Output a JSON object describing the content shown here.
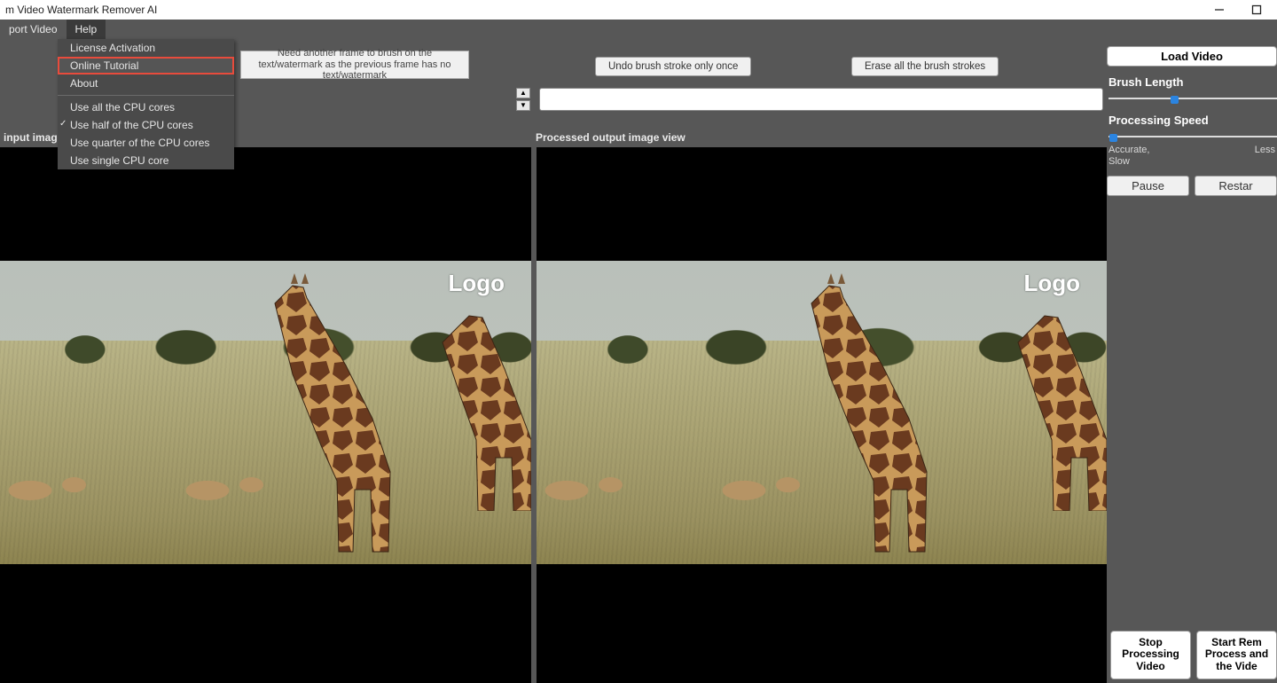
{
  "title": "m Video Watermark Remover AI",
  "menubar": {
    "export": "port Video",
    "help": "Help"
  },
  "help_menu": {
    "items": [
      {
        "label": "License Activation"
      },
      {
        "label": "Online Tutorial",
        "highlight": true
      },
      {
        "label": "About"
      }
    ],
    "cpu_items": [
      {
        "label": "Use all the CPU cores"
      },
      {
        "label": "Use half of the CPU cores",
        "checked": true
      },
      {
        "label": "Use quarter of the CPU cores"
      },
      {
        "label": "Use single CPU core"
      }
    ]
  },
  "hint": "Need another frame to brush on the text/watermark as the previous frame has no text/watermark",
  "toolbar": {
    "undo": "Undo brush stroke only once",
    "erase": "Erase all the brush strokes"
  },
  "panel_headers": {
    "left": "input image",
    "right": "Processed output image view"
  },
  "overlay_text": "Logo",
  "sidebar": {
    "load": "Load Video",
    "brush_label": "Brush Length",
    "speed_label": "Processing Speed",
    "speed_left": "Accurate,\nSlow",
    "speed_right": "Less ",
    "pause": "Pause",
    "restart": "Restar",
    "stop": "Stop Processing Video",
    "start": "Start Rem\nProcess and\nthe Vide"
  }
}
